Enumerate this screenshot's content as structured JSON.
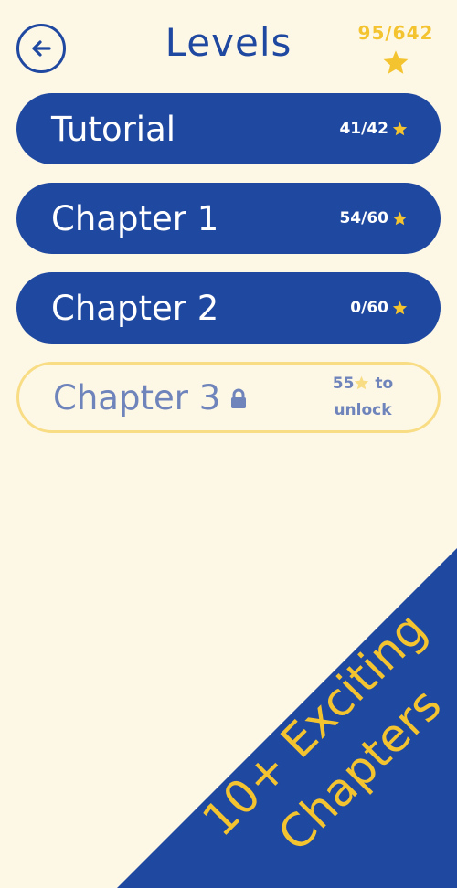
{
  "header": {
    "title": "Levels",
    "total_stars": "95/642",
    "back_icon": "arrow-left-icon"
  },
  "chapters": [
    {
      "name": "Tutorial",
      "progress": "41/42",
      "locked": false
    },
    {
      "name": "Chapter 1",
      "progress": "54/60",
      "locked": false
    },
    {
      "name": "Chapter 2",
      "progress": "0/60",
      "locked": false
    },
    {
      "name": "Chapter 3",
      "unlock_cost": "55",
      "unlock_suffix": "to",
      "unlock_word": "unlock",
      "locked": true
    }
  ],
  "promo": {
    "line1": "10+ Exciting",
    "line2": "Chapters"
  },
  "colors": {
    "background": "#fdf7e6",
    "primary": "#1f48a0",
    "star": "#f4c430",
    "locked_text": "#6e84bb",
    "locked_border": "#f8dd84"
  }
}
